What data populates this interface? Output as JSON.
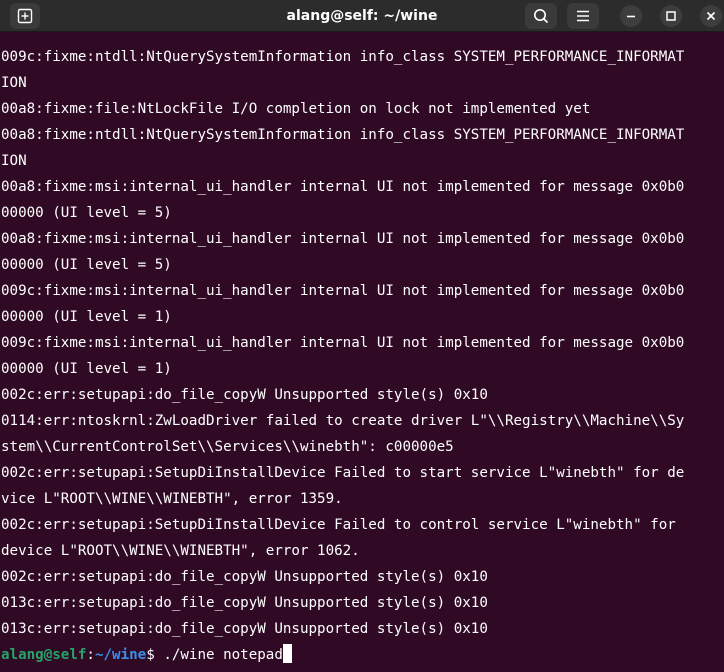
{
  "window": {
    "title": "alang@self: ~/wine"
  },
  "titlebar": {
    "new_tab_icon": "new-tab-icon",
    "search_icon": "search-icon",
    "menu_icon": "hamburger-menu-icon",
    "minimize_icon": "minimize-icon",
    "maximize_icon": "maximize-icon",
    "close_icon": "close-icon"
  },
  "terminal": {
    "lines": [
      "009c:fixme:ntdll:NtQuerySystemInformation info_class SYSTEM_PERFORMANCE_INFORMAT",
      "ION",
      "00a8:fixme:file:NtLockFile I/O completion on lock not implemented yet",
      "00a8:fixme:ntdll:NtQuerySystemInformation info_class SYSTEM_PERFORMANCE_INFORMAT",
      "ION",
      "00a8:fixme:msi:internal_ui_handler internal UI not implemented for message 0x0b0",
      "00000 (UI level = 5)",
      "00a8:fixme:msi:internal_ui_handler internal UI not implemented for message 0x0b0",
      "00000 (UI level = 5)",
      "009c:fixme:msi:internal_ui_handler internal UI not implemented for message 0x0b0",
      "00000 (UI level = 1)",
      "009c:fixme:msi:internal_ui_handler internal UI not implemented for message 0x0b0",
      "00000 (UI level = 1)",
      "002c:err:setupapi:do_file_copyW Unsupported style(s) 0x10",
      "0114:err:ntoskrnl:ZwLoadDriver failed to create driver L\"\\\\Registry\\\\Machine\\\\Sy",
      "stem\\\\CurrentControlSet\\\\Services\\\\winebth\": c00000e5",
      "002c:err:setupapi:SetupDiInstallDevice Failed to start service L\"winebth\" for de",
      "vice L\"ROOT\\\\WINE\\\\WINEBTH\", error 1359.",
      "002c:err:setupapi:SetupDiInstallDevice Failed to control service L\"winebth\" for",
      "device L\"ROOT\\\\WINE\\\\WINEBTH\", error 1062.",
      "002c:err:setupapi:do_file_copyW Unsupported style(s) 0x10",
      "013c:err:setupapi:do_file_copyW Unsupported style(s) 0x10",
      "013c:err:setupapi:do_file_copyW Unsupported style(s) 0x10"
    ],
    "prompt": {
      "user_host": "alang@self",
      "separator": ":",
      "path": "~/wine",
      "symbol": "$ ",
      "command": "./wine notepad"
    }
  },
  "colors": {
    "background": "#300a24",
    "text": "#ffffff",
    "prompt_user": "#26a269",
    "prompt_path": "#3b8eea",
    "titlebar": "#2c2c2c"
  }
}
